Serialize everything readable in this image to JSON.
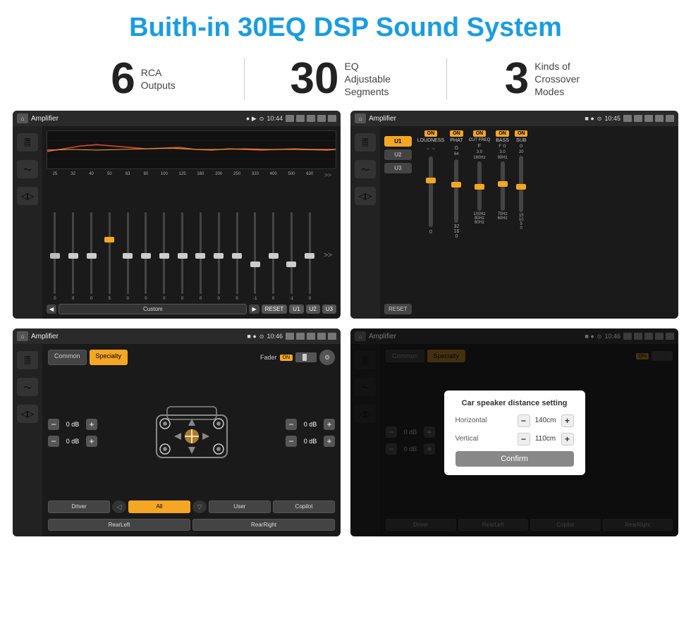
{
  "header": {
    "title": "Buith-in 30EQ DSP Sound System"
  },
  "stats": [
    {
      "number": "6",
      "label": "RCA\nOutputs"
    },
    {
      "number": "30",
      "label": "EQ Adjustable\nSegments"
    },
    {
      "number": "3",
      "label": "Kinds of\nCrossover Modes"
    }
  ],
  "screens": [
    {
      "id": "eq-screen",
      "title": "Amplifier",
      "time": "10:44",
      "type": "eq"
    },
    {
      "id": "crossover-screen",
      "title": "Amplifier",
      "time": "10:45",
      "type": "crossover"
    },
    {
      "id": "fader-screen",
      "title": "Amplifier",
      "time": "10:46",
      "type": "fader"
    },
    {
      "id": "dialog-screen",
      "title": "Amplifier",
      "time": "10:46",
      "type": "dialog"
    }
  ],
  "eq": {
    "freqs": [
      "25",
      "32",
      "40",
      "50",
      "63",
      "80",
      "100",
      "125",
      "160",
      "200",
      "250",
      "320",
      "400",
      "500",
      "630"
    ],
    "values": [
      "0",
      "0",
      "0",
      "5",
      "0",
      "0",
      "0",
      "0",
      "0",
      "0",
      "0",
      "-1",
      "0",
      "-1"
    ],
    "presets": [
      "Custom",
      "RESET",
      "U1",
      "U2",
      "U3"
    ]
  },
  "crossover": {
    "presets": [
      "U1",
      "U2",
      "U3"
    ],
    "controls": [
      "LOUDNESS",
      "PHAT",
      "CUT FREQ",
      "BASS",
      "SUB"
    ],
    "on_label": "ON",
    "reset_label": "RESET"
  },
  "fader": {
    "tabs": [
      "Common",
      "Specialty"
    ],
    "fader_label": "Fader",
    "on_label": "ON",
    "volume_labels": [
      "0 dB",
      "0 dB",
      "0 dB",
      "0 dB"
    ],
    "buttons": [
      "Driver",
      "RearLeft",
      "All",
      "User",
      "RearRight",
      "Copilot"
    ]
  },
  "dialog": {
    "title": "Car speaker distance setting",
    "horizontal_label": "Horizontal",
    "horizontal_value": "140cm",
    "vertical_label": "Vertical",
    "vertical_value": "110cm",
    "confirm_label": "Confirm",
    "right_vol1": "0 dB",
    "right_vol2": "0 dB"
  }
}
